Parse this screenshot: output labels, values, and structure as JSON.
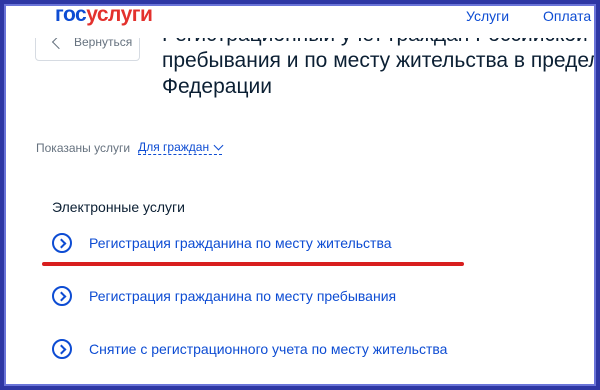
{
  "header": {
    "logo_part1": "гос",
    "logo_part2": "услуги",
    "nav": [
      "Услуги",
      "Оплата"
    ]
  },
  "back_button": {
    "label": "Вернуться"
  },
  "title": {
    "lines": [
      "Регистрационный учет граждан Российской",
      "пребывания и по месту жительства в предел",
      "Федерации"
    ]
  },
  "audience_filter": {
    "label": "Показаны услуги",
    "selected": "Для граждан"
  },
  "electronic_services": {
    "heading": "Электронные услуги",
    "items": [
      "Регистрация гражданина по месту жительства",
      "Регистрация гражданина по месту пребывания",
      "Снятие с регистрационного учета по месту жительства"
    ]
  },
  "colors": {
    "brand_blue": "#0d4cd3",
    "brand_red": "#e3312d",
    "highlight_red": "#d81e1e",
    "frame": "#2e37a4"
  }
}
